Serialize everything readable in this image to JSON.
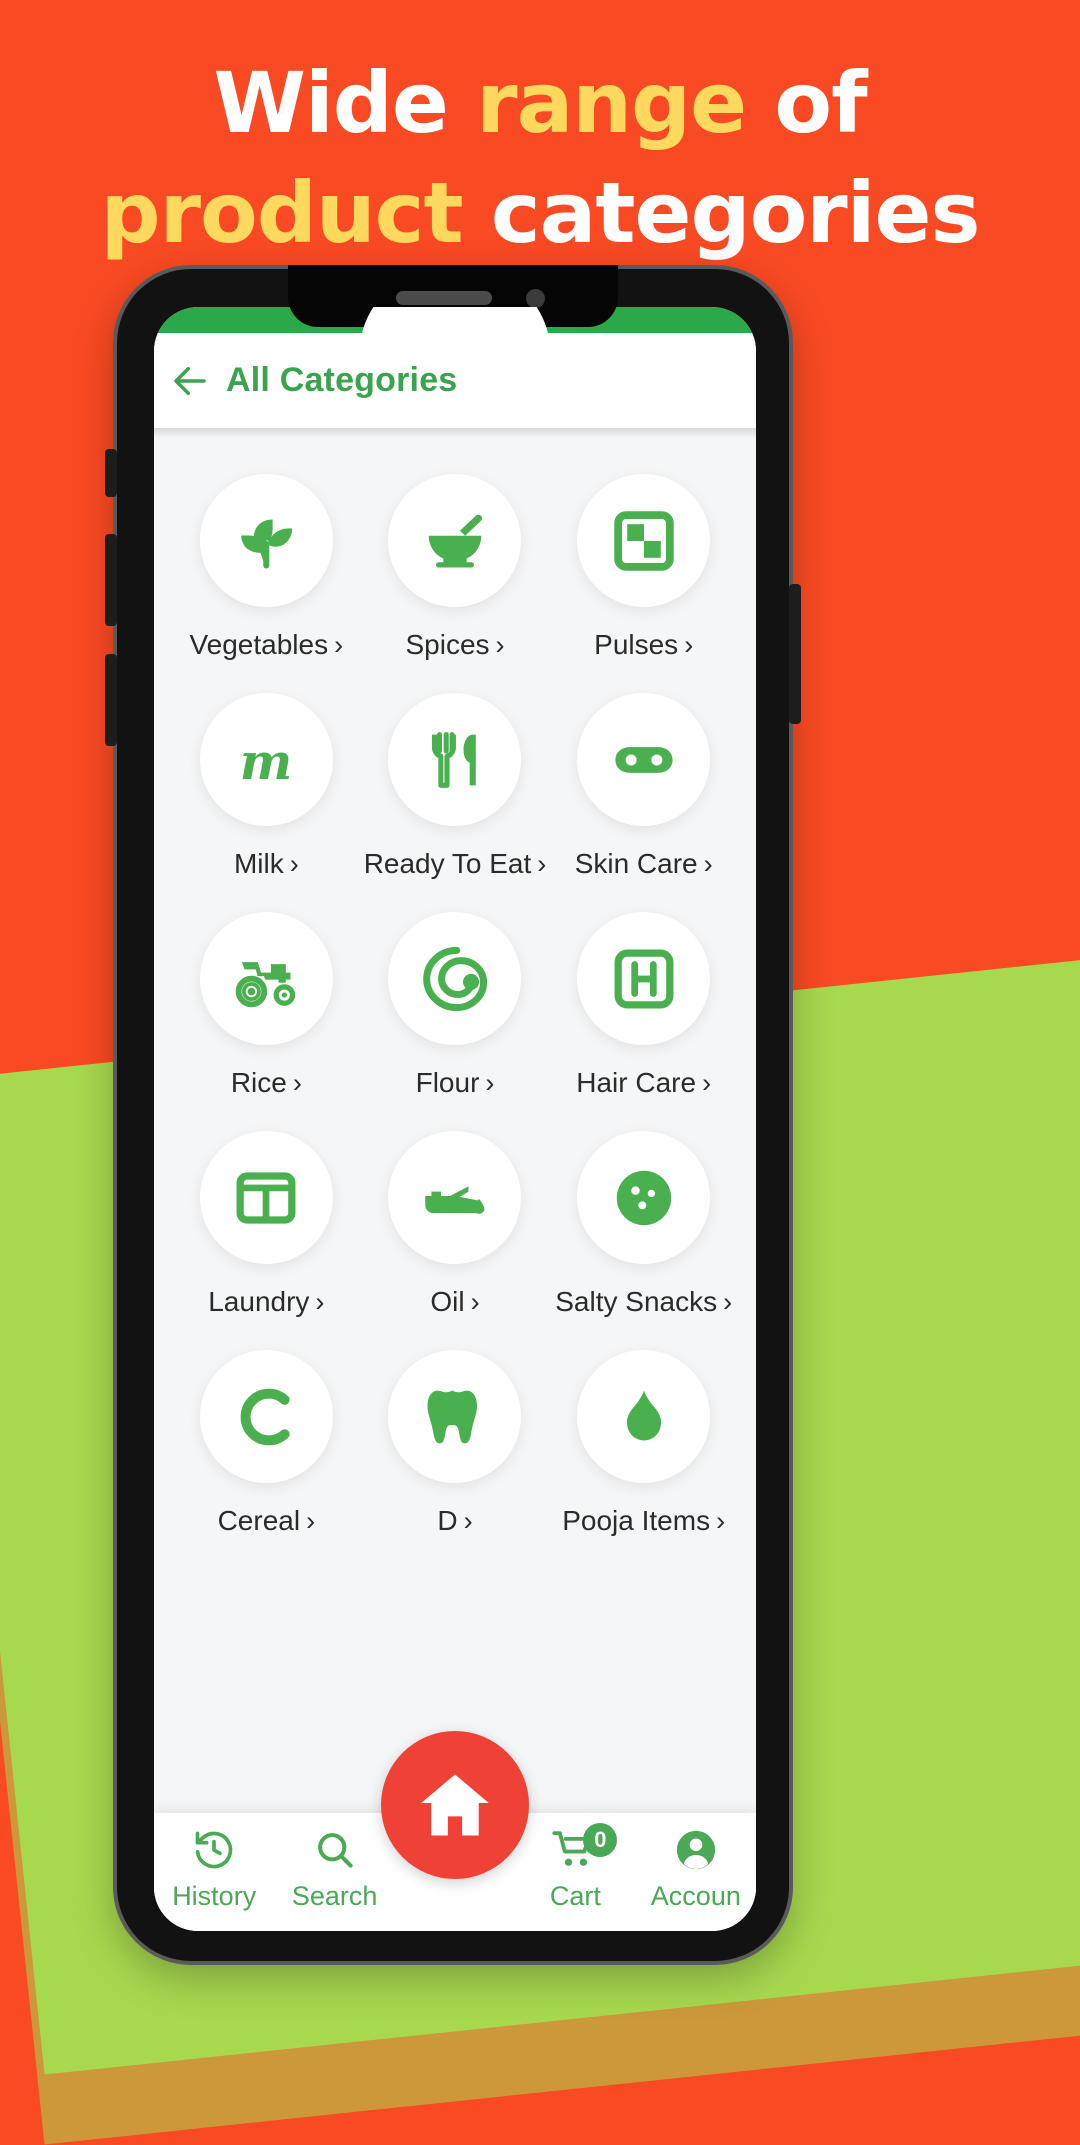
{
  "headline": {
    "line1_part1": "Wide ",
    "line1_accent": "range",
    "line1_part2": " of",
    "line2_accent": "product",
    "line2_part2": " categories"
  },
  "colors": {
    "background_orange": "#fa4a23",
    "background_green": "#a7d94f",
    "headline_white": "#ffffff",
    "headline_yellow": "#ffd95e",
    "brand_green": "#3aa34f",
    "icon_green": "#4aaf4f",
    "fab_red": "#ef4135",
    "statusbar_green": "#2aa84a"
  },
  "app": {
    "header": {
      "back_icon": "arrow-left-icon",
      "title": "All Categories"
    },
    "categories": [
      {
        "label": "Vegetables",
        "chevron": "›",
        "icon": "seedling-icon"
      },
      {
        "label": "Spices",
        "chevron": "›",
        "icon": "mortar-pestle-icon"
      },
      {
        "label": "Pulses",
        "chevron": "›",
        "icon": "checkerboard-icon"
      },
      {
        "label": "Milk",
        "chevron": "›",
        "icon": "milk-m-logo-icon"
      },
      {
        "label": "Ready To Eat",
        "chevron": "›",
        "icon": "fork-knife-icon"
      },
      {
        "label": "Skin Care",
        "chevron": "›",
        "icon": "mask-icon"
      },
      {
        "label": "Rice",
        "chevron": "›",
        "icon": "tractor-icon"
      },
      {
        "label": "Flour",
        "chevron": "›",
        "icon": "steam-swirl-icon"
      },
      {
        "label": "Hair Care",
        "chevron": "›",
        "icon": "h-square-icon"
      },
      {
        "label": "Laundry",
        "chevron": "›",
        "icon": "window-panes-icon"
      },
      {
        "label": "Oil",
        "chevron": "›",
        "icon": "oil-can-icon"
      },
      {
        "label": "Salty Snacks",
        "chevron": "›",
        "icon": "cookie-icon"
      },
      {
        "label": "Cereal",
        "chevron": "›",
        "icon": "c-letter-icon"
      },
      {
        "label": "D",
        "chevron": "›",
        "icon": "tooth-icon"
      },
      {
        "label": "Pooja Items",
        "chevron": "›",
        "icon": "flame-icon"
      }
    ],
    "bottom_nav": [
      {
        "label": "History",
        "icon": "history-clock-icon"
      },
      {
        "label": "Search",
        "icon": "search-icon"
      },
      {
        "label": "Cart",
        "icon": "shopping-cart-icon",
        "badge": "0"
      },
      {
        "label": "Accoun",
        "icon": "account-person-icon"
      }
    ],
    "fab": {
      "icon": "home-icon",
      "label": "Home"
    }
  }
}
